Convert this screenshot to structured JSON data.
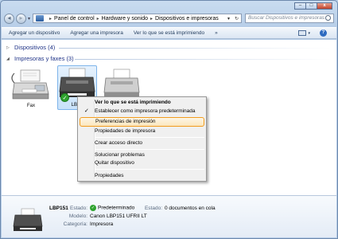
{
  "window": {
    "controls": {
      "minimize": "–",
      "maximize": "□",
      "close": "x"
    }
  },
  "address": {
    "back": "◂",
    "forward": "▸",
    "history": "▾",
    "crumbs": [
      "Panel de control",
      "Hardware y sonido",
      "Dispositivos e impresoras"
    ],
    "dropdown": "▾",
    "refresh": "↻",
    "search_placeholder": "Buscar Dispositivos e impresoras"
  },
  "cmdbar": {
    "add_device": "Agregar un dispositivo",
    "add_printer": "Agregar una impresora",
    "see_printing": "Ver lo que se está imprimiendo",
    "more": "»",
    "help": "?"
  },
  "groups": {
    "devices": "Dispositivos (4)",
    "printers": "Impresoras y faxes (3)"
  },
  "printers": [
    {
      "label": "Fax"
    },
    {
      "label": "LBP1"
    },
    {
      "label": ""
    }
  ],
  "context_menu": {
    "items": [
      "Ver lo que se está imprimiendo",
      "Establecer como impresora predeterminada",
      "Preferencias de impresión",
      "Propiedades de impresora",
      "Crear acceso directo",
      "Solucionar problemas",
      "Quitar dispositivo",
      "Propiedades"
    ],
    "check": "✓"
  },
  "details": {
    "name": "LBP151",
    "estado_key": "Estado:",
    "estado_val": "Predeterminado",
    "estado2_key": "Estado:",
    "estado2_val": "0 documentos en cola",
    "modelo_key": "Modelo:",
    "modelo_val": "Canon LBP151 UFRII LT",
    "categoria_key": "Categoría:",
    "categoria_val": "Impresora"
  }
}
